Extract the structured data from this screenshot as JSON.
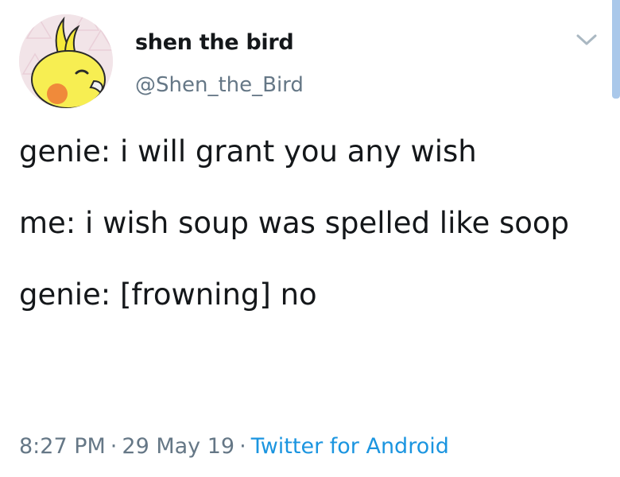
{
  "user": {
    "display_name": "shen the bird",
    "handle": "@Shen_the_Bird",
    "avatar_icon": "cockatiel-avatar-icon"
  },
  "menu_icon": "chevron-down-icon",
  "tweet": {
    "lines": [
      "genie: i will grant you any wish",
      "me: i wish soup was spelled like soop",
      "genie: [frowning] no"
    ]
  },
  "meta": {
    "time": "8:27 PM",
    "separator": "·",
    "date": "29 May 19",
    "source": "Twitter for Android"
  },
  "colors": {
    "text": "#14171a",
    "secondary": "#657786",
    "link": "#1b95e0",
    "scrollbar": "#aac8ea"
  }
}
